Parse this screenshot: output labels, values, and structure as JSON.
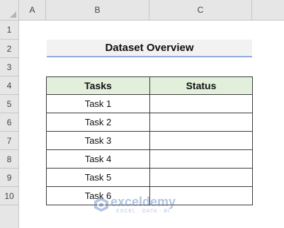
{
  "columns": [
    "A",
    "B",
    "C"
  ],
  "rows": [
    "1",
    "2",
    "3",
    "4",
    "5",
    "6",
    "7",
    "8",
    "9",
    "10"
  ],
  "title": "Dataset Overview",
  "table": {
    "headers": [
      "Tasks",
      "Status"
    ],
    "rows": [
      {
        "task": "Task 1",
        "status": ""
      },
      {
        "task": "Task 2",
        "status": ""
      },
      {
        "task": "Task 3",
        "status": ""
      },
      {
        "task": "Task 4",
        "status": ""
      },
      {
        "task": "Task 5",
        "status": ""
      },
      {
        "task": "Task 6",
        "status": ""
      }
    ]
  },
  "watermark": {
    "name": "exceldemy",
    "tagline": "EXCEL · DATA · BI",
    "icon": "exceldemy-logo-icon"
  },
  "colors": {
    "header_fill": "#e2efda",
    "title_fill": "#f2f2f2",
    "title_border": "#8ea9db"
  }
}
